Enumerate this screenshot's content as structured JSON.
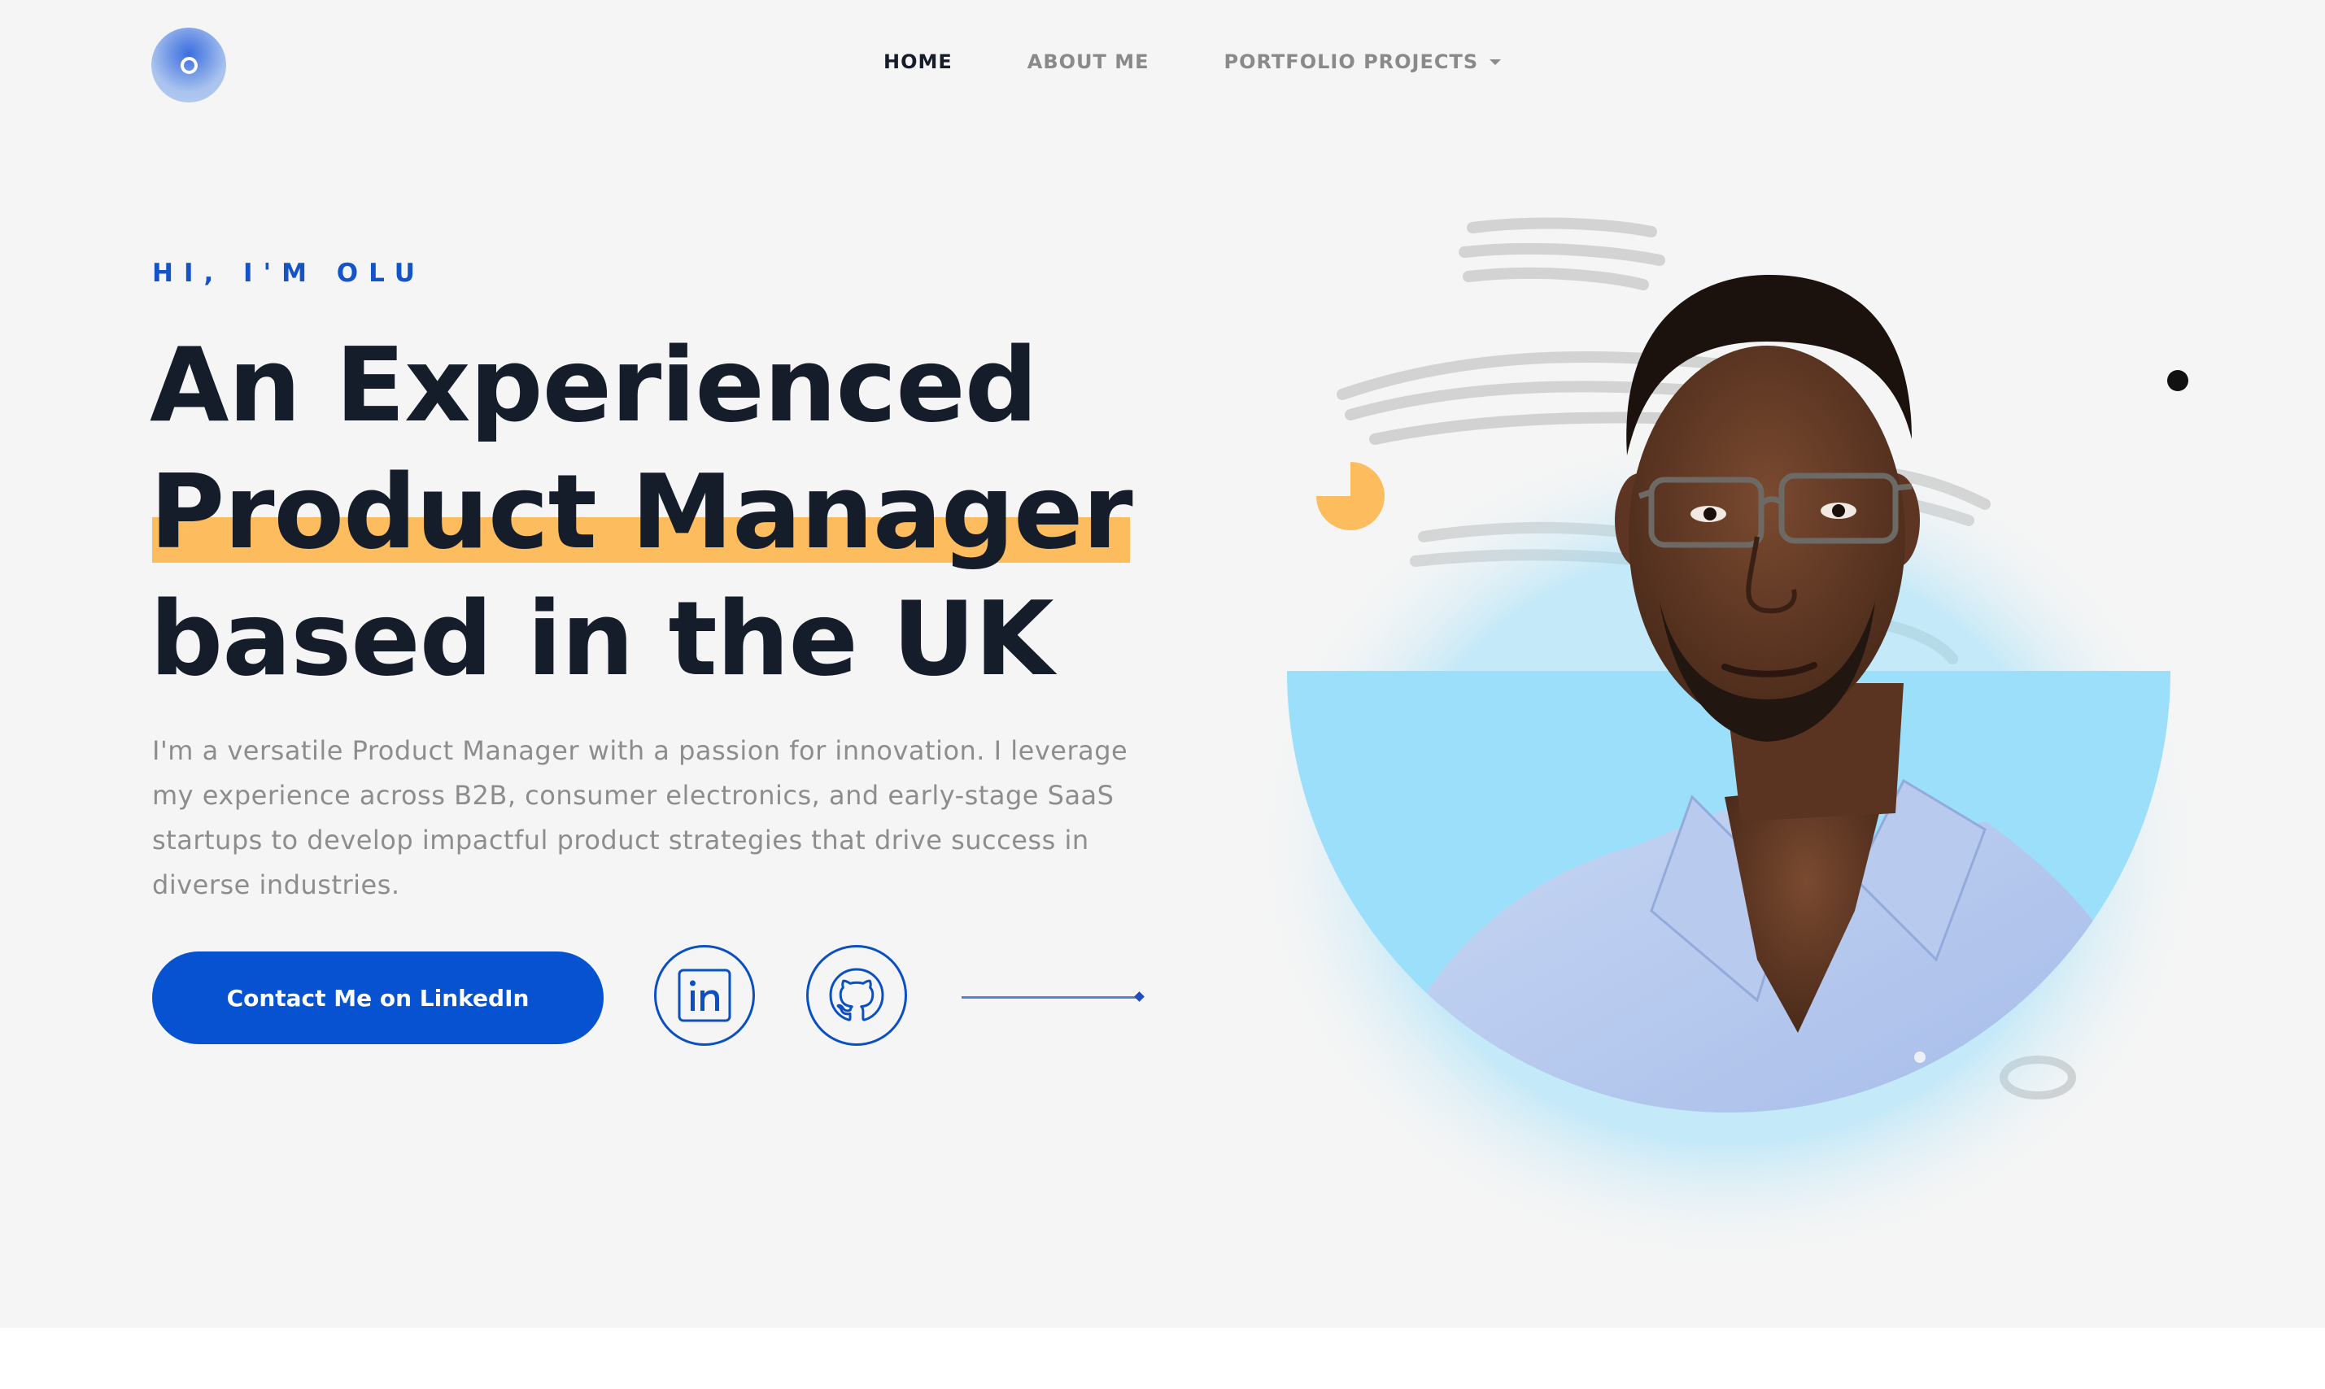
{
  "nav": {
    "items": [
      {
        "label": "HOME",
        "active": true
      },
      {
        "label": "ABOUT ME",
        "active": false
      },
      {
        "label": "PORTFOLIO PROJECTS",
        "active": false,
        "has_dropdown": true
      }
    ]
  },
  "hero": {
    "eyebrow": "HI, I'M OLU",
    "headline": {
      "line1": "An Experienced",
      "line2": "Product Manager",
      "line3": "based in the UK"
    },
    "description": "I'm a versatile Product Manager with a passion for innovation. I leverage my experience across B2B, consumer electronics, and early-stage SaaS startups to develop impactful product strategies that drive success in diverse industries.",
    "cta_label": "Contact Me on LinkedIn",
    "social": [
      {
        "icon": "linkedin-icon"
      },
      {
        "icon": "github-icon"
      }
    ]
  },
  "colors": {
    "accent_blue": "#0652d1",
    "highlight_yellow": "#fdbc5e",
    "heading_dark": "#161d2a",
    "hero_background": "#f5f5f5",
    "portrait_background": "#9cdffa"
  }
}
